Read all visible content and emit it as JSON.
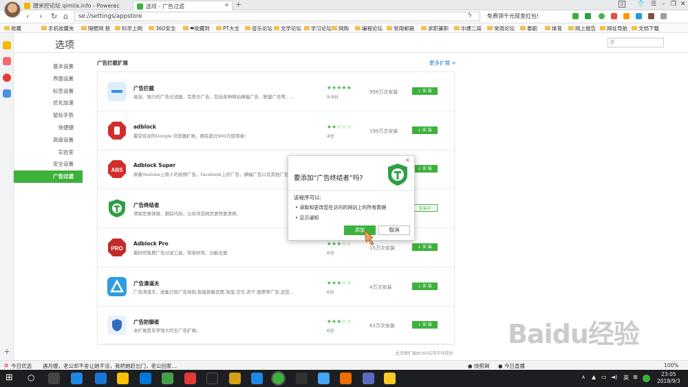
{
  "tabs": [
    {
      "label": "蹭米控论坛 qimila.info - Powerec"
    },
    {
      "label": "选项 - 广告过滤"
    }
  ],
  "window_badge": "2",
  "address": {
    "url": "se://settings/appstore",
    "promo": "免费领千元现金红包!"
  },
  "bookmarks": [
    "收藏",
    "手机收藏夹",
    "隔壁网 新",
    "科学上网",
    "360安全",
    "❤收藏到",
    "PT大全",
    "音乐论坛",
    "文学论坛",
    "学习论坛",
    "网购",
    "编程论坛",
    "常用邮箱",
    "求职兼职",
    "中建二局",
    "常用论坛",
    "泰剧",
    "体育",
    "网上报告",
    "网址导航",
    "文档下载"
  ],
  "settings": {
    "title": "选项",
    "search_placeholder": "",
    "menu": [
      "基本设置",
      "界面设置",
      "标签设置",
      "优化加速",
      "鼠标手势",
      "快捷键",
      "高级设置",
      "实验室",
      "安全设置",
      "广告过滤"
    ],
    "section_title": "广告拦截扩展",
    "more_link": "更多扩展 >",
    "footnote": "此页面扩展由360应用市场提供"
  },
  "extensions": [
    {
      "name": "广告拦截",
      "desc": "高效、强力的广告过滤器，完美去广告，包括各种网站横幅广告、联盟广告等、…",
      "stars": "★★★★★",
      "score": "9.9分",
      "installs": "958万次安装",
      "button": "↓ 安 装",
      "color": "#3a8ee6"
    },
    {
      "name": "adblock",
      "desc": "最受欢迎的Google 浏览器扩展，拥有超过900万使用者!",
      "stars": "★★☆☆☆",
      "score": "4分",
      "installs": "199万次安装",
      "button": "↓ 安 装",
      "color": "#d22d2d"
    },
    {
      "name": "Adblock Super",
      "desc": "屏蔽Youtube上烦人的视频广告，Facebook上的广告，横幅广告以及其他广告",
      "stars": "",
      "score": "",
      "installs": "",
      "button": "↓ 安 装",
      "color": "#d22d2d"
    },
    {
      "name": "广告终结者",
      "desc": "清除恶意弹窗、跟踪代码，让你浏览网页更快更清爽。",
      "stars": "",
      "score": "",
      "installs": "",
      "button": "安装中",
      "color": "#2ea043"
    },
    {
      "name": "Adblock Pro",
      "desc": "最好的免费广告过滤工具，简单好用、功能全面",
      "stars": "★★★☆☆",
      "score": "6分",
      "installs": "15万次安装",
      "button": "↓ 安 装",
      "color": "#c42a2a"
    },
    {
      "name": "广告清道夫",
      "desc": "广告清道夫，收集已知广告规则,智能屏蔽百度,淘宝,京东,苏宁,国美等广告,还您…",
      "stars": "★★★☆☆",
      "score": "6分",
      "installs": "4万次安装",
      "button": "↓ 安 装",
      "color": "#2f9be0"
    },
    {
      "name": "广告防御者",
      "desc": "本扩展是非常强大的去广告扩展。",
      "stars": "★★★☆☆",
      "score": "6分",
      "installs": "63万次安装",
      "button": "↓ 安 装",
      "color": "#2d6cc0"
    }
  ],
  "dialog": {
    "title": "要添加“广告终结者”吗?",
    "subtitle": "该程序可以:",
    "permissions": [
      "读取和更改您在访问的网站上的所有数据",
      "显示通知"
    ],
    "ok": "添加",
    "cancel": "取消"
  },
  "statusbar": {
    "left": "今日优选",
    "news": "遇月嫂，老公却不舍让她干活，我把她赶出门，老公回家…",
    "right1": "快剪辑",
    "right2": "今日直播",
    "zoom": "100%"
  },
  "taskbar": {
    "ime": "英",
    "time": "23:05",
    "date": "2018/9/3"
  },
  "watermark": "Baidu经验",
  "colors": {
    "accent": "#3cb13c",
    "link": "#2b7bd6"
  }
}
